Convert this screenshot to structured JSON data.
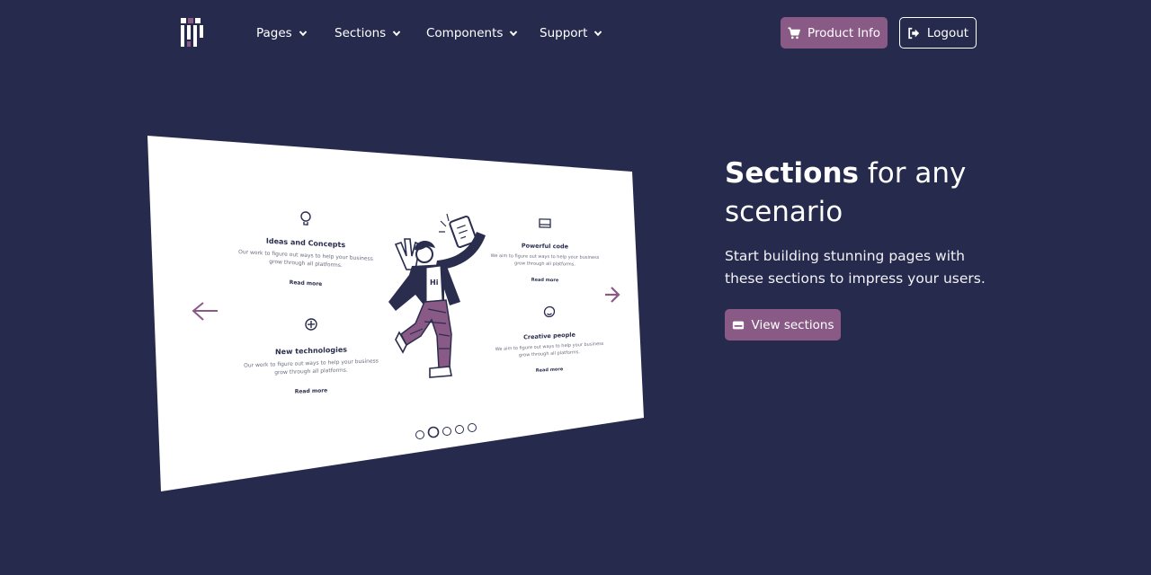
{
  "nav": {
    "items": [
      {
        "label": "Pages"
      },
      {
        "label": "Sections"
      },
      {
        "label": "Components"
      },
      {
        "label": "Support"
      }
    ],
    "product_info_label": "Product Info",
    "logout_label": "Logout"
  },
  "hero": {
    "title_bold": "Sections",
    "title_rest": " for any scenario",
    "subtitle": "Start building stunning pages with these sections to impress your users.",
    "cta_label": "View sections"
  },
  "mockup": {
    "features": [
      {
        "title": "Ideas and Concepts",
        "text1": "Our work to figure out ways to help your business",
        "text2": "grow through all platforms.",
        "link": "Read more",
        "icon": "lightbulb-icon"
      },
      {
        "title": "New technologies",
        "text1": "Our work to figure out ways to help your business",
        "text2": "grow through all platforms.",
        "link": "Read more",
        "icon": "tech-icon"
      },
      {
        "title": "Powerful code",
        "text1": "We aim to figure out ways to help your business",
        "text2": "grow through all platforms.",
        "link": "Read more",
        "icon": "code-icon"
      },
      {
        "title": "Creative people",
        "text1": "We aim to figure out ways to help your business",
        "text2": "grow through all platforms.",
        "link": "Read more",
        "icon": "smile-icon"
      }
    ],
    "badge_text": "Hi"
  },
  "colors": {
    "background": "#262b4d",
    "accent": "#8a5a87",
    "white": "#ffffff"
  }
}
